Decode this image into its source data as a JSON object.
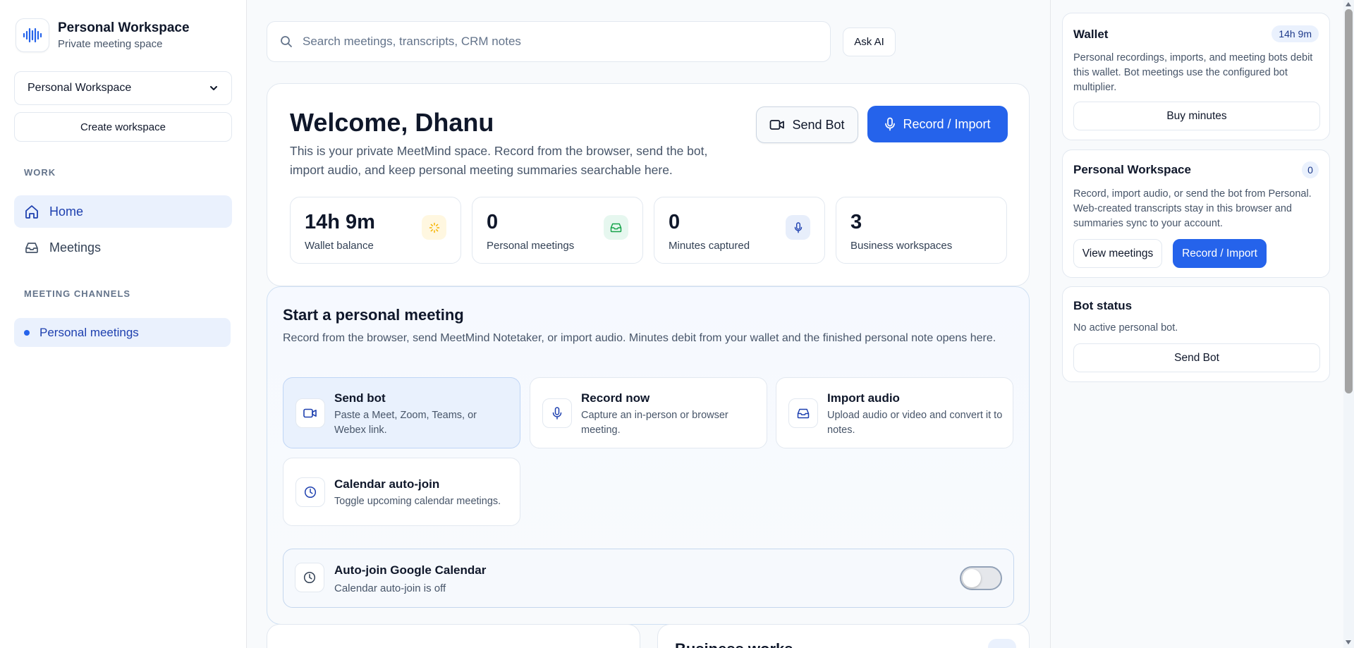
{
  "brand": {
    "title": "Personal Workspace",
    "subtitle": "Private meeting space",
    "logo_icon": "audio-waveform-icon"
  },
  "sidebar": {
    "workspace_select": "Personal Workspace",
    "create_workspace": "Create workspace",
    "work_section": "WORK",
    "nav": [
      {
        "label": "Home",
        "icon": "home-icon",
        "active": true
      },
      {
        "label": "Meetings",
        "icon": "inbox-icon",
        "active": false
      }
    ],
    "channels_section": "MEETING CHANNELS",
    "channels": [
      {
        "label": "Personal meetings",
        "active": true
      }
    ]
  },
  "search": {
    "placeholder": "Search meetings, transcripts, CRM notes",
    "ask_ai": "Ask AI"
  },
  "welcome": {
    "title": "Welcome, Dhanu",
    "intro": "This is your private MeetMind space. Record from the browser, send the bot, import audio, and keep personal meeting summaries searchable here.",
    "send_bot": "Send Bot",
    "record_import": "Record / Import",
    "stats": [
      {
        "value": "14h 9m",
        "label": "Wallet balance",
        "icon": "sun-icon"
      },
      {
        "value": "0",
        "label": "Personal meetings",
        "icon": "inbox-icon"
      },
      {
        "value": "0",
        "label": "Minutes captured",
        "icon": "microphone-icon"
      },
      {
        "value": "3",
        "label": "Business workspaces",
        "icon": ""
      }
    ]
  },
  "start_meeting": {
    "title": "Start a personal meeting",
    "description": "Record from the browser, send MeetMind Notetaker, or import audio. Minutes debit from your wallet and the finished personal note opens here.",
    "options": [
      {
        "title": "Send bot",
        "desc": "Paste a Meet, Zoom, Teams, or Webex link.",
        "icon": "video-camera-icon",
        "selected": true
      },
      {
        "title": "Record now",
        "desc": "Capture an in-person or browser meeting.",
        "icon": "microphone-icon",
        "selected": false
      },
      {
        "title": "Import audio",
        "desc": "Upload audio or video and convert it to notes.",
        "icon": "inbox-icon",
        "selected": false
      },
      {
        "title": "Calendar auto-join",
        "desc": "Toggle upcoming calendar meetings.",
        "icon": "clock-icon",
        "selected": false
      }
    ],
    "autojoin": {
      "title": "Auto-join Google Calendar",
      "status": "Calendar auto-join is off",
      "enabled": false
    }
  },
  "bottom": {
    "right_card_title": "Business works"
  },
  "right_panel": {
    "wallet": {
      "title": "Wallet",
      "badge": "14h 9m",
      "desc": "Personal recordings, imports, and meeting bots debit this wallet. Bot meetings use the configured bot multiplier.",
      "button": "Buy minutes"
    },
    "personal": {
      "title": "Personal Workspace",
      "badge": "0",
      "desc": "Record, import audio, or send the bot from Personal. Web-created transcripts stay in this browser and summaries sync to your account.",
      "view_meetings": "View meetings",
      "record_import": "Record / Import"
    },
    "bot_status": {
      "title": "Bot status",
      "desc": "No active personal bot.",
      "button": "Send Bot"
    }
  },
  "colors": {
    "accent": "#2563eb",
    "active_bg": "#eaf1fd",
    "text": "#0f172a",
    "muted": "#475569"
  }
}
